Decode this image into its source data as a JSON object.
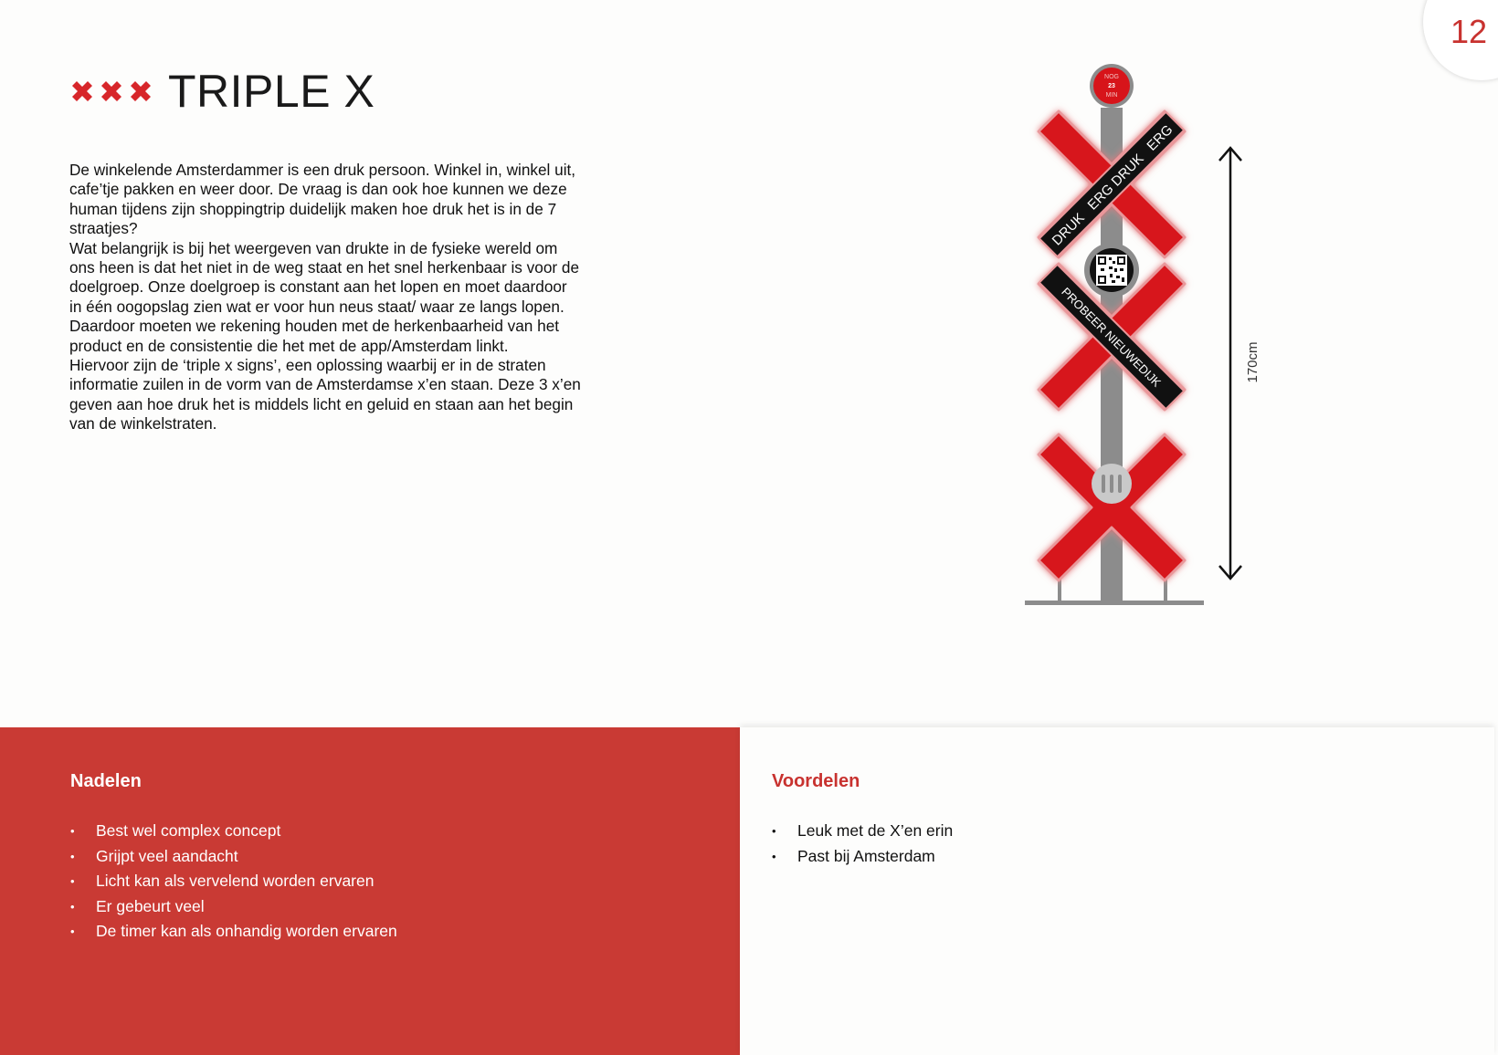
{
  "page": {
    "number": "12"
  },
  "header": {
    "title": "TRIPLE X",
    "logo_icon": "amsterdam-xxx-icon",
    "accent": "#c8322f"
  },
  "body": {
    "paragraphs": [
      "De winkelende Amsterdammer is een druk persoon. Winkel in, winkel uit, cafe’tje pakken en weer door. De vraag is dan ook hoe kunnen we deze human tijdens zijn shoppingtrip duidelijk maken hoe druk het is in de 7 straatjes?",
      "Wat belangrijk is bij het weergeven van drukte in de fysieke wereld om ons heen is dat het niet in de weg staat en het snel herkenbaar is voor de doelgroep. Onze doelgroep is constant aan het lopen en moet daardoor in één oogopslag zien wat er voor hun neus staat/ waar ze langs lopen. Daardoor moeten we rekening houden met de herkenbaarheid van het product en de consistentie die het met de app/Amsterdam linkt.",
      "Hiervoor zijn de ‘triple x signs’, een oplossing waarbij er in de straten informatie zuilen in de vorm van de Amsterdamse x’en staan. Deze 3 x’en geven aan hoe druk het is middels licht en geluid en staan aan het begin van de winkelstraten."
    ]
  },
  "sign": {
    "timer": {
      "line1": "NOG",
      "line2": "23",
      "line3": "MIN"
    },
    "band1": "DRUK   ERG DRUK   ERG",
    "band2": "PROBEER NIEUWEDIJK",
    "height_label": "170cm",
    "colors": {
      "red": "#d7141a",
      "pole": "#8c8c8c",
      "band": "#111111"
    }
  },
  "nadelen": {
    "title": "Nadelen",
    "bg": "#c93a34",
    "items": [
      "Best wel complex concept",
      "Grijpt veel aandacht",
      "Licht kan als vervelend worden ervaren",
      "Er gebeurt veel",
      "De timer kan als onhandig worden ervaren"
    ]
  },
  "voordelen": {
    "title": "Voordelen",
    "items": [
      "Leuk met de X’en erin",
      "Past bij Amsterdam"
    ]
  }
}
